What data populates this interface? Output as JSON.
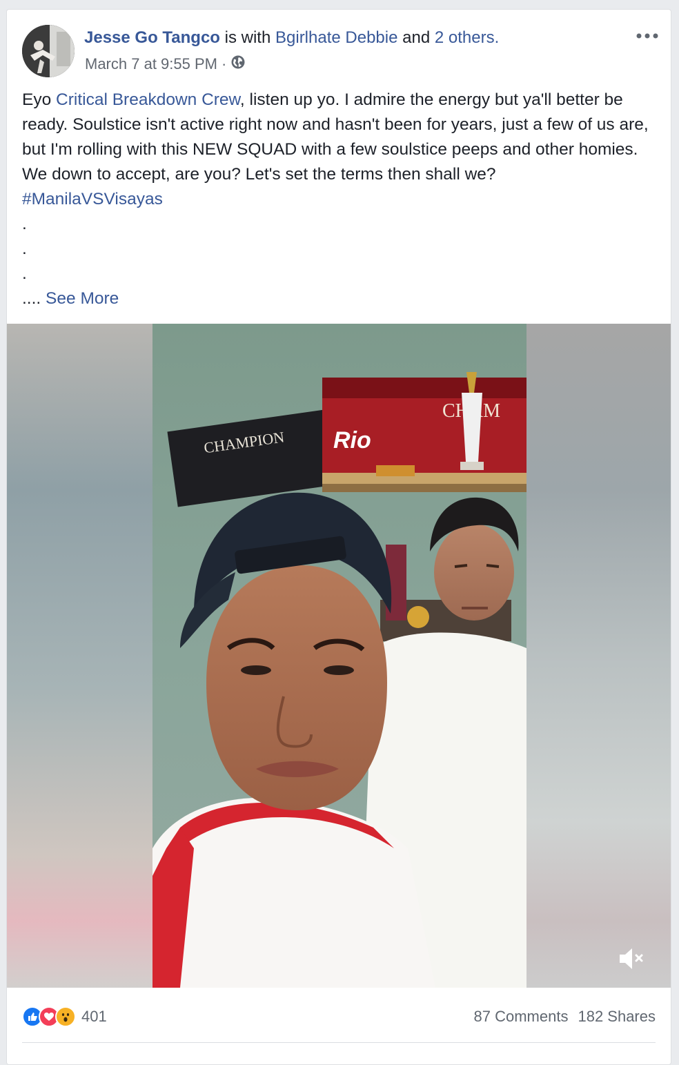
{
  "post": {
    "author": "Jesse Go Tangco",
    "with_prefix": "is with",
    "tagged_person": "Bgirlhate Debbie",
    "and_word": "and",
    "others_link": "2 others.",
    "timestamp": "March 7 at 9:55 PM",
    "separator": "·",
    "privacy_icon": "globe-icon",
    "more_icon": "more-options-icon",
    "text": {
      "prefix": "Eyo",
      "mention": "Critical Breakdown Crew",
      "body": ", listen up yo. I admire the energy but ya'll better be ready. Soulstice isn't active right now and hasn't been for years, just a few of us are, but I'm rolling with this NEW SQUAD with a few soulstice peeps and other homies. We down to accept, are you? Let's set the terms then shall we?",
      "hashtag": "#ManilaVSVisayas",
      "dots": [
        ".",
        ".",
        "."
      ],
      "ellipsis": "....",
      "see_more": "See More"
    }
  },
  "video": {
    "poster_text": [
      "CHAMPION",
      "Rio",
      "CHAM"
    ],
    "mute_icon": "muted-speaker-icon"
  },
  "footer": {
    "reaction_icons": [
      "like-icon",
      "love-icon",
      "wow-icon"
    ],
    "reaction_count": "401",
    "comments": "87 Comments",
    "shares": "182 Shares"
  },
  "colors": {
    "link": "#385898",
    "text": "#1d2129",
    "meta": "#616770",
    "like": "#1877f2",
    "love": "#f33e58",
    "wow": "#f7b125"
  }
}
